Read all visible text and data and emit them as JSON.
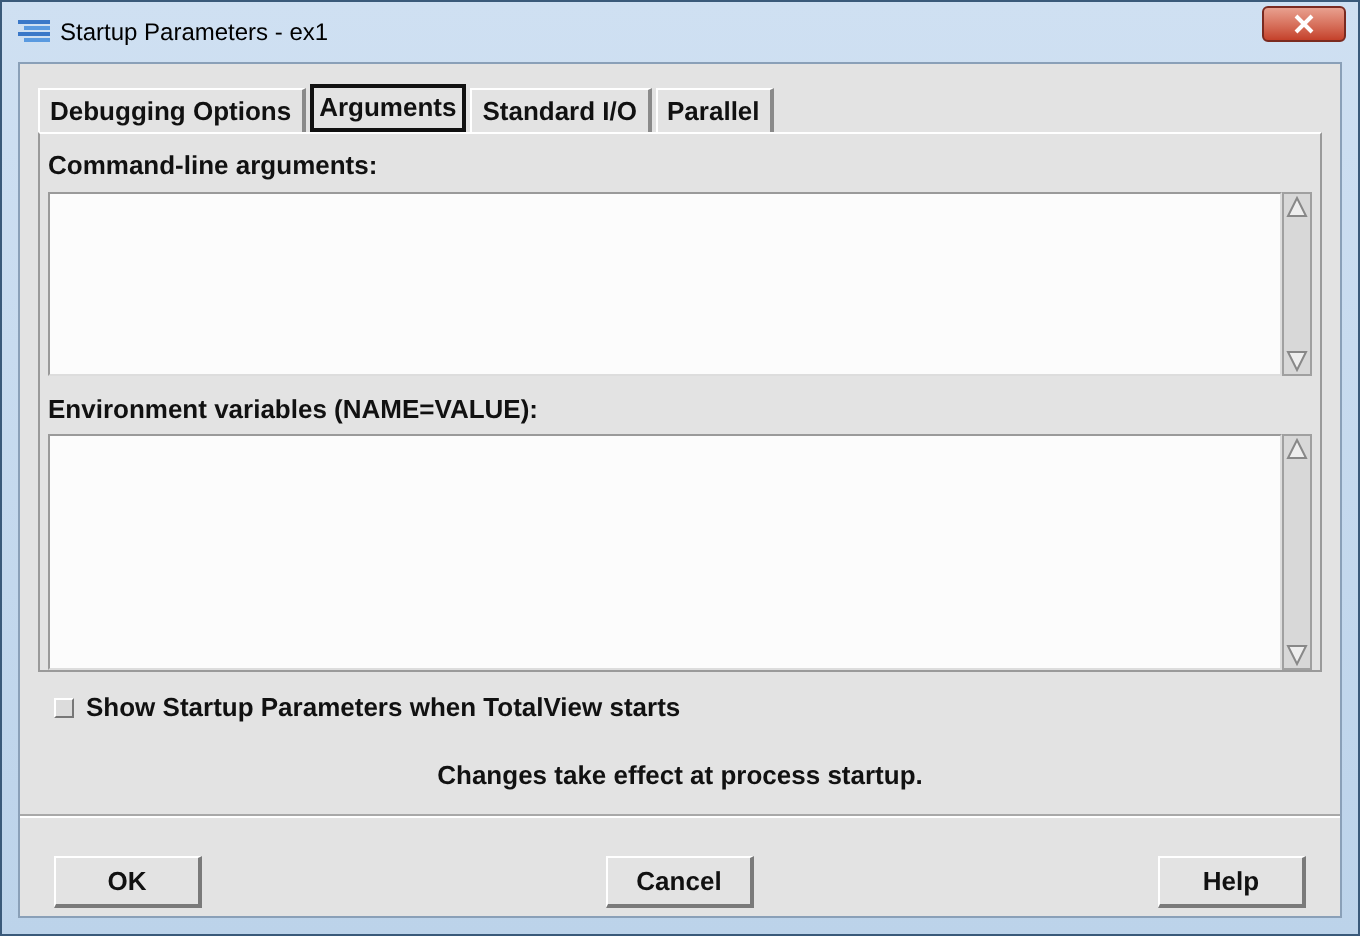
{
  "window": {
    "title": "Startup Parameters - ex1"
  },
  "tabs": [
    {
      "label": "Debugging Options",
      "selected": false
    },
    {
      "label": "Arguments",
      "selected": true
    },
    {
      "label": "Standard I/O",
      "selected": false
    },
    {
      "label": "Parallel",
      "selected": false
    }
  ],
  "fields": [
    {
      "label": "Command-line arguments:"
    },
    {
      "label": "Environment variables (NAME=VALUE):"
    }
  ],
  "show_on_start": {
    "label": "Show Startup Parameters when TotalView starts",
    "checked": false
  },
  "message": "Changes take effect at process startup.",
  "buttons": [
    "OK",
    "Cancel",
    "Help"
  ]
}
